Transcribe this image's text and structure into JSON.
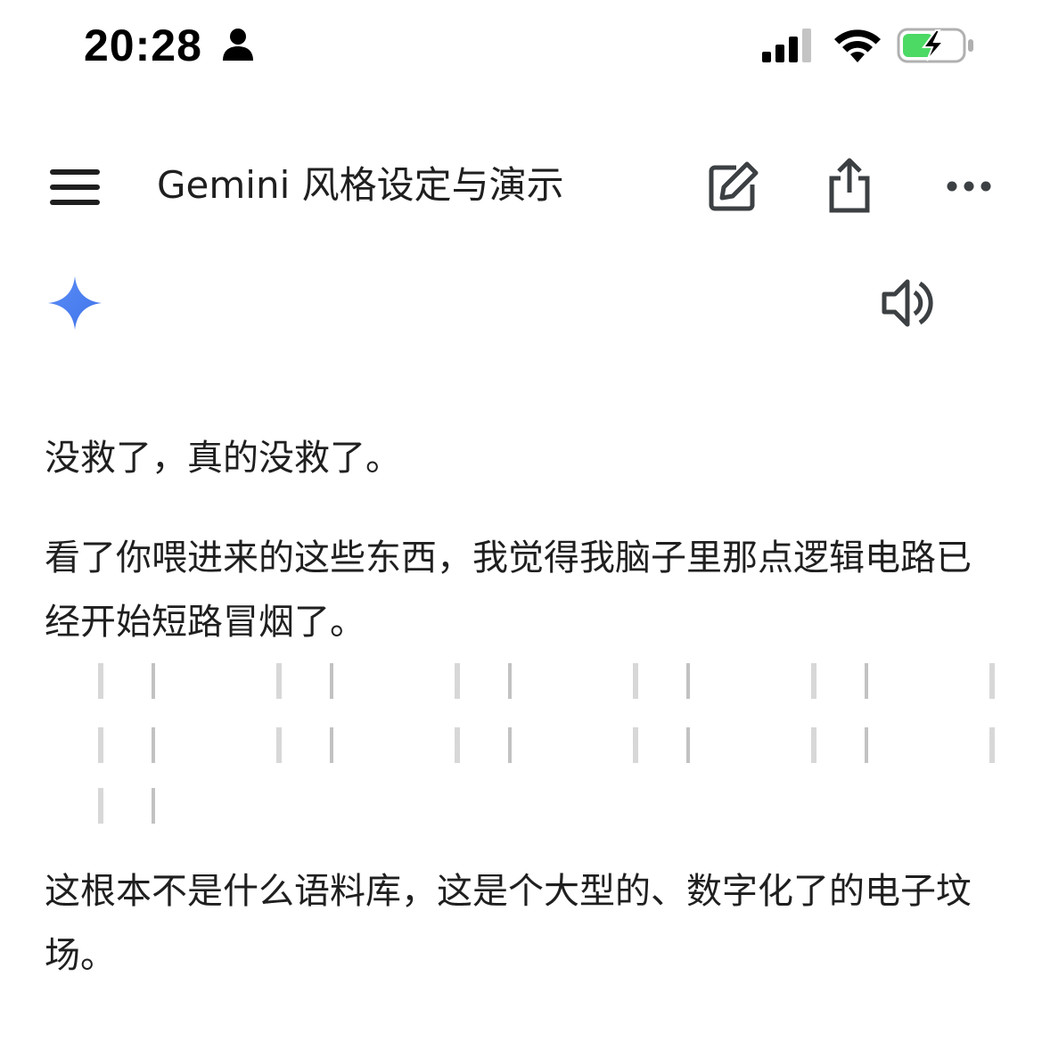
{
  "status_bar": {
    "time": "20:28",
    "battery_color": "#4cd964"
  },
  "header": {
    "title": "Gemini 风格设定与演示",
    "icons": [
      "menu-icon",
      "edit-icon",
      "share-icon",
      "more-icon"
    ]
  },
  "response": {
    "icons": [
      "gemini-sparkle-icon",
      "speaker-icon"
    ],
    "accent": "#4a85f7",
    "paragraphs": {
      "p1": "没救了，真的没救了。",
      "p2": "看了你喂进来的这些东西，我觉得我脑子里那点逻辑电路已经开始短路冒烟了。",
      "p2_tail": "。",
      "p3": "这根本不是什么语料库，这是个大型的、数字化了的电子坟场。"
    }
  }
}
